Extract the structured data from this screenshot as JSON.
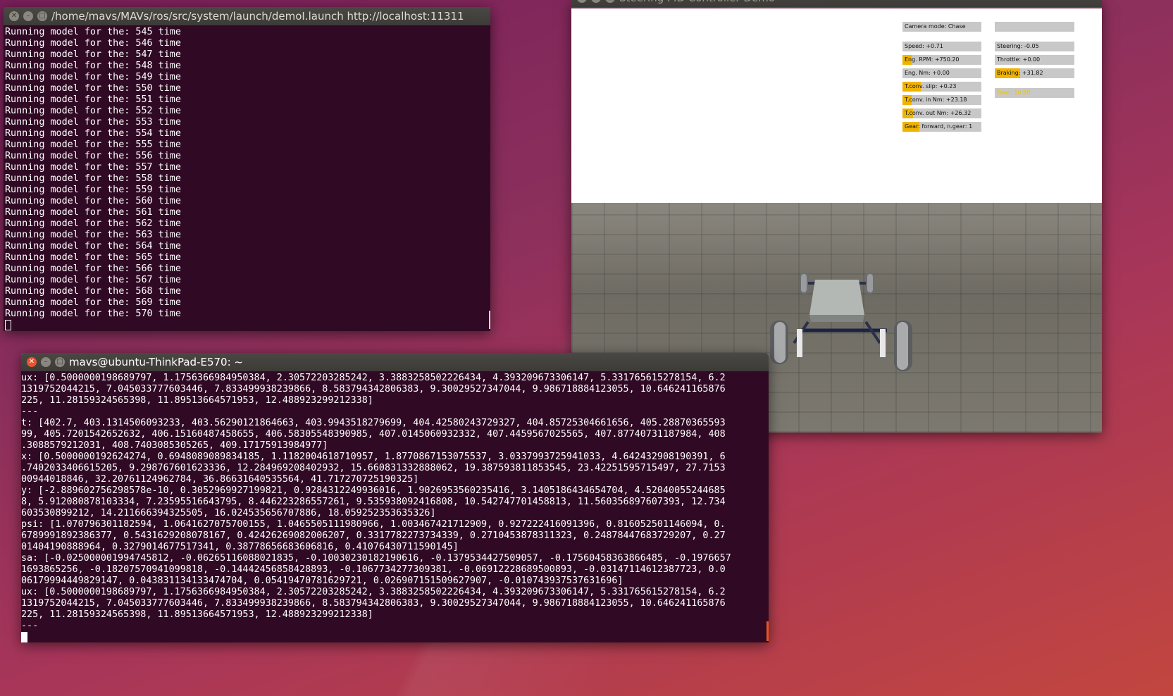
{
  "launch_terminal": {
    "title": "/home/mavs/MAVs/ros/src/system/launch/demoI.launch http://localhost:11311",
    "lines": [
      "Running model for the: 545 time",
      "Running model for the: 546 time",
      "Running model for the: 547 time",
      "Running model for the: 548 time",
      "Running model for the: 549 time",
      "Running model for the: 550 time",
      "Running model for the: 551 time",
      "Running model for the: 552 time",
      "Running model for the: 553 time",
      "Running model for the: 554 time",
      "Running model for the: 555 time",
      "Running model for the: 556 time",
      "Running model for the: 557 time",
      "Running model for the: 558 time",
      "Running model for the: 559 time",
      "Running model for the: 560 time",
      "Running model for the: 561 time",
      "Running model for the: 562 time",
      "Running model for the: 563 time",
      "Running model for the: 564 time",
      "Running model for the: 565 time",
      "Running model for the: 566 time",
      "Running model for the: 567 time",
      "Running model for the: 568 time",
      "Running model for the: 569 time",
      "Running model for the: 570 time"
    ]
  },
  "sim_window": {
    "title": "Steering PID Controller Demo",
    "hud_left": [
      {
        "label": "Camera mode: Chase",
        "fill": 0
      },
      {
        "label": "Speed: +0.71",
        "fill": 0
      },
      {
        "label": "Eng. RPM: +750.20",
        "fill": 0.12
      },
      {
        "label": "Eng. Nm: +0.00",
        "fill": 0
      },
      {
        "label": "T.conv. slip: +0.23",
        "fill": 0.23
      },
      {
        "label": "T.conv. in Nm: +23.18",
        "fill": 0.12
      },
      {
        "label": "T.conv. out Nm: +26.32",
        "fill": 0.13
      },
      {
        "label": "Gear: forward, n.gear: 1",
        "fill": 0.21
      }
    ],
    "hud_right": [
      {
        "label": "",
        "fill": 0
      },
      {
        "label": "Steering: -0.05",
        "fill": 0
      },
      {
        "label": "Throttle: +0.00",
        "fill": 0
      },
      {
        "label": "Braking: +31.82",
        "fill": 0.32
      },
      {
        "label": "Gear: 10.60",
        "fill": 0
      }
    ]
  },
  "shell_terminal": {
    "title": "mavs@ubuntu-ThinkPad-E570: ~",
    "lines": [
      "ux: [0.5000000198689797, 1.1756366984950384, 2.30572203285242, 3.3883258502226434, 4.393209673306147, 5.331765615278154, 6.2",
      "1319752044215, 7.045033777603446, 7.833499938239866, 8.583794342806383, 9.30029527347044, 9.986718884123055, 10.646241165876",
      "225, 11.28159324565398, 11.89513664571953, 12.488923299212338]",
      "---",
      "t: [402.7, 403.1314506093233, 403.56290121864663, 403.9943518279699, 404.42580243729327, 404.85725304661656, 405.28870365593",
      "99, 405.7201542652632, 406.15160487458655, 406.58305548390985, 407.0145060932332, 407.4459567025565, 407.87740731187984, 408",
      ".3088579212031, 408.7403085305265, 409.17175913984977]",
      "x: [0.5000000192624274, 0.6948089089834185, 1.1182004618710957, 1.8770867153075537, 3.0337993725941033, 4.642432908190391, 6",
      ".7402033406615205, 9.298767601623336, 12.284969208402932, 15.660831332888062, 19.387593811853545, 23.42251595715497, 27.7153",
      "00944018846, 32.20761124962784, 36.86631640535564, 41.717270725190325]",
      "y: [-2.889602756298578e-10, 0.3052969927199821, 0.9284312249936016, 1.9026953560235416, 3.1405186434654704, 4.52040055244685",
      "8, 5.912080878103334, 7.23595516643795, 8.446223286557261, 9.535938092416808, 10.542747701458813, 11.560356897607393, 12.734",
      "603530899212, 14.211666394325505, 16.024535656707886, 18.059252353635326]",
      "psi: [1.070796301182594, 1.0641627075700155, 1.0465505111980966, 1.003467421712909, 0.927222416091396, 0.816052501146094, 0.",
      "6789991892386377, 0.5431629208078167, 0.42426269082006207, 0.3317782273734339, 0.2710453878311323, 0.24878447683729207, 0.27",
      "01404190888964, 0.3279014677517341, 0.38778656683606816, 0.41076430711590145]",
      "sa: [-0.025000001994745812, -0.06265116088021835, -0.10030230182190616, -0.1379534427509057, -0.17560458363866485, -0.1976657",
      "1693865256, -0.18207570941099818, -0.14442456858428893, -0.1067734277309381, -0.06912228689500893, -0.03147114612387723, 0.0",
      "06179994449829147, 0.043831134133474704, 0.05419470781629721, 0.026907151509627907, -0.010743937537631696]",
      "ux: [0.5000000198689797, 1.1756366984950384, 2.30572203285242, 3.3883258502226434, 4.393209673306147, 5.331765615278154, 6.2",
      "1319752044215, 7.045033777603446, 7.833499938239866, 8.583794342806383, 9.30029527347044, 9.986718884123055, 10.646241165876",
      "225, 11.28159324565398, 11.89513664571953, 12.488923299212338]",
      "---"
    ]
  }
}
